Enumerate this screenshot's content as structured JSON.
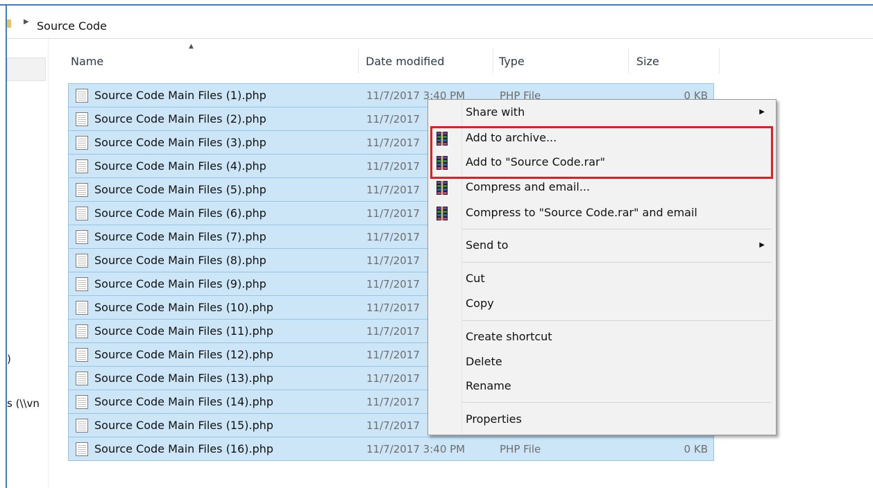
{
  "address": {
    "path": "Source Code",
    "chevron_icon": "chevron-right-icon"
  },
  "nav": {
    "fragment_1": ")",
    "fragment_2": "s (\\\\vn"
  },
  "columns": {
    "name": "Name",
    "date": "Date modified",
    "type": "Type",
    "size": "Size",
    "sort_icon": "sort-ascending-icon"
  },
  "files": [
    {
      "name": "Source Code Main Files (1).php",
      "date": "11/7/2017 3:40 PM",
      "type": "PHP File",
      "size": "0 KB"
    },
    {
      "name": "Source Code Main Files (2).php",
      "date": "11/7/2017",
      "type": "",
      "size": ""
    },
    {
      "name": "Source Code Main Files (3).php",
      "date": "11/7/2017",
      "type": "",
      "size": ""
    },
    {
      "name": "Source Code Main Files (4).php",
      "date": "11/7/2017",
      "type": "",
      "size": ""
    },
    {
      "name": "Source Code Main Files (5).php",
      "date": "11/7/2017",
      "type": "",
      "size": ""
    },
    {
      "name": "Source Code Main Files (6).php",
      "date": "11/7/2017",
      "type": "",
      "size": ""
    },
    {
      "name": "Source Code Main Files (7).php",
      "date": "11/7/2017",
      "type": "",
      "size": ""
    },
    {
      "name": "Source Code Main Files (8).php",
      "date": "11/7/2017",
      "type": "",
      "size": ""
    },
    {
      "name": "Source Code Main Files (9).php",
      "date": "11/7/2017",
      "type": "",
      "size": ""
    },
    {
      "name": "Source Code Main Files (10).php",
      "date": "11/7/2017",
      "type": "",
      "size": ""
    },
    {
      "name": "Source Code Main Files (11).php",
      "date": "11/7/2017",
      "type": "",
      "size": ""
    },
    {
      "name": "Source Code Main Files (12).php",
      "date": "11/7/2017",
      "type": "",
      "size": ""
    },
    {
      "name": "Source Code Main Files (13).php",
      "date": "11/7/2017",
      "type": "",
      "size": ""
    },
    {
      "name": "Source Code Main Files (14).php",
      "date": "11/7/2017",
      "type": "",
      "size": ""
    },
    {
      "name": "Source Code Main Files (15).php",
      "date": "11/7/2017",
      "type": "",
      "size": ""
    },
    {
      "name": "Source Code Main Files (16).php",
      "date": "11/7/2017 3:40 PM",
      "type": "PHP File",
      "size": "0 KB"
    }
  ],
  "context_menu": {
    "share_with": "Share with",
    "add_to_archive": "Add to archive...",
    "add_to_rar": "Add to \"Source Code.rar\"",
    "compress_email": "Compress and email...",
    "compress_rar_email": "Compress to \"Source Code.rar\" and email",
    "send_to": "Send to",
    "cut": "Cut",
    "copy": "Copy",
    "create_shortcut": "Create shortcut",
    "delete": "Delete",
    "rename": "Rename",
    "properties": "Properties",
    "archive_icon": "winrar-icon",
    "submenu_icon": "submenu-arrow-icon"
  },
  "colors": {
    "selection": "#cce6f8",
    "selection_border": "#94c4e6",
    "highlight": "#e02020",
    "menu_bg": "#f2f2f2"
  }
}
